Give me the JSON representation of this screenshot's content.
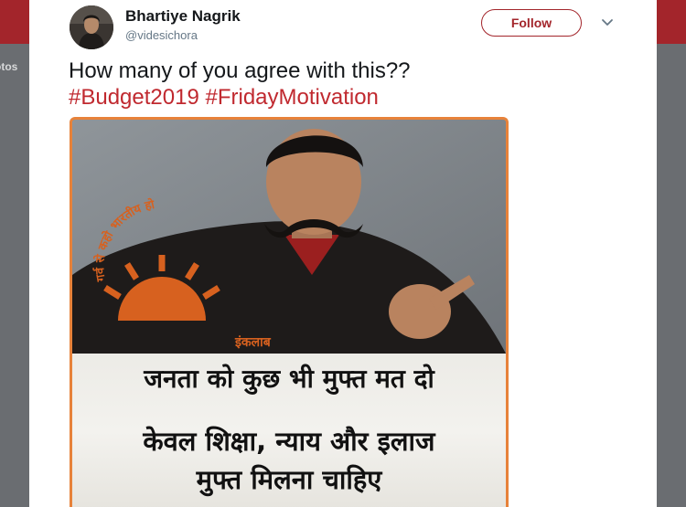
{
  "left_nav": {
    "label": "otos"
  },
  "tweet": {
    "author_name": "Bhartiye Nagrik",
    "author_handle": "@videsichora",
    "follow_label": "Follow",
    "text": "How many of you agree with this??",
    "hashtags": [
      "#Budget2019",
      "#FridayMotivation"
    ]
  },
  "media": {
    "arc_text": "गर्व से कहो भारतीय हो",
    "jacket_text": "इंकलाब",
    "caption_line1": "जनता को कुछ भी मुफ्त मत दो",
    "caption_line2": "केवल शिक्षा, न्याय और इलाज",
    "caption_line3": "मुफ्त मिलना चाहिए"
  },
  "colors": {
    "brand_red": "#a3252b",
    "hashtag_red": "#c0292f",
    "media_border": "#e7823a"
  },
  "icons": {
    "more_menu": "chevron-down-icon"
  }
}
